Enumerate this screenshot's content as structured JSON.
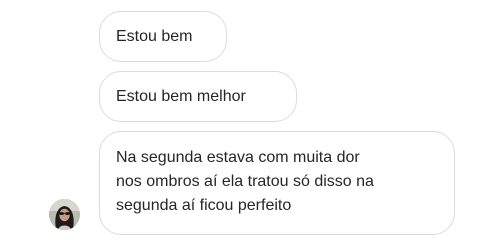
{
  "chat": {
    "messages": [
      {
        "text": "Estou bem"
      },
      {
        "text": "Estou bem melhor"
      },
      {
        "lines": [
          "Na segunda estava com muita dor",
          "nos ombros aí ela tratou só disso na",
          "segunda aí ficou perfeito"
        ]
      }
    ],
    "sender_avatar": {
      "icon": "person-avatar"
    }
  },
  "colors": {
    "bubble_border": "#dbdbdb",
    "text": "#262626",
    "background": "#ffffff"
  }
}
